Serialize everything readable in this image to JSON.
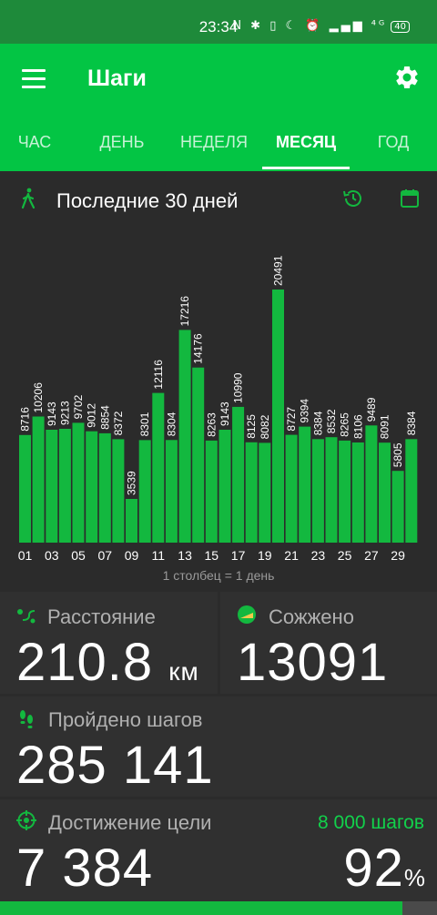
{
  "status_bar": {
    "time": "23:34",
    "icons": "N ✱ ▯ ☾ ⏰ ▂▄▆ ⁴ᴳ",
    "battery": "40"
  },
  "app": {
    "title": "Шаги",
    "menu_icon": "hamburger-menu-icon",
    "settings_icon": "gear-icon"
  },
  "tabs": [
    {
      "label": "ЧАС"
    },
    {
      "label": "ДЕНЬ"
    },
    {
      "label": "НЕДЕЛЯ"
    },
    {
      "label": "МЕСЯЦ"
    },
    {
      "label": "ГОД"
    }
  ],
  "active_tab": "МЕСЯЦ",
  "chart_header": {
    "title": "Последние 30 дней",
    "icons": [
      "walking-person-icon",
      "history-icon",
      "calendar-icon"
    ]
  },
  "chart_data": {
    "type": "bar",
    "categories": [
      "01",
      "02",
      "03",
      "04",
      "05",
      "06",
      "07",
      "08",
      "09",
      "10",
      "11",
      "12",
      "13",
      "14",
      "15",
      "16",
      "17",
      "18",
      "19",
      "20",
      "21",
      "22",
      "23",
      "24",
      "25",
      "26",
      "27",
      "28",
      "29",
      "30"
    ],
    "values": [
      8716,
      10206,
      9143,
      9213,
      9702,
      9012,
      8854,
      8372,
      3539,
      8301,
      12116,
      8304,
      17216,
      14176,
      8263,
      9143,
      10990,
      8125,
      8082,
      20491,
      8727,
      9394,
      8384,
      8532,
      8265,
      8106,
      9489,
      8091,
      5805,
      8384
    ],
    "tick_labels": [
      "01",
      "03",
      "05",
      "07",
      "09",
      "11",
      "13",
      "15",
      "17",
      "19",
      "21",
      "23",
      "25",
      "27",
      "29"
    ],
    "ylim": [
      0,
      20491
    ],
    "footer": "1 столбец = 1 день",
    "bar_color": "#13b83f"
  },
  "stats": {
    "distance": {
      "label": "Расстояние",
      "value": "210.8",
      "unit": "км",
      "icon": "route-icon"
    },
    "burned": {
      "label": "Сожжено",
      "value": "13091",
      "icon": "scale-icon"
    },
    "steps": {
      "label": "Пройдено шагов",
      "value": "285 141",
      "icon": "footsteps-icon"
    },
    "goal": {
      "label": "Достижение цели",
      "target": "8 000 шагов",
      "value": "7 384",
      "percent": "92",
      "percent_sign": "%",
      "icon": "target-icon",
      "progress": 0.92
    }
  },
  "colors": {
    "accent": "#03c544",
    "status_bar": "#1e8a3a",
    "background": "#2b2b2b",
    "card": "#303030",
    "green_text": "#12d14b"
  }
}
